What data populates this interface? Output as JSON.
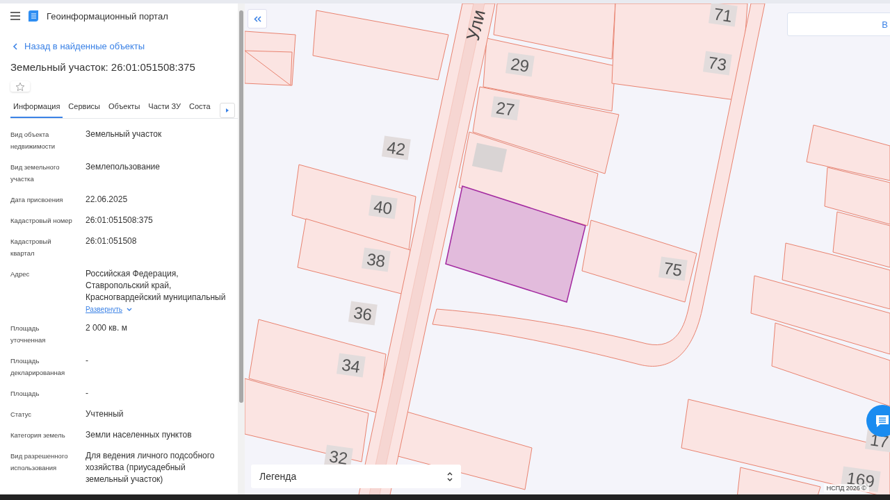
{
  "header": {
    "title": "Геоинформационный портал"
  },
  "back_link": "Назад в найденные объекты",
  "object_title": "Земельный участок: 26:01:051508:375",
  "favorite": {
    "on": false
  },
  "tabs": [
    {
      "label": "Информация",
      "selected": true
    },
    {
      "label": "Сервисы",
      "selected": false
    },
    {
      "label": "Объекты",
      "selected": false
    },
    {
      "label": "Части ЗУ",
      "selected": false
    },
    {
      "label": "Соста",
      "selected": false
    }
  ],
  "fields": [
    {
      "label": "Вид объекта недвижимости",
      "value": "Земельный участок"
    },
    {
      "label": "Вид земельного участка",
      "value": "Землепользование"
    },
    {
      "label": "Дата присвоения",
      "value": "22.06.2025"
    },
    {
      "label": "Кадастровый номер",
      "value": "26:01:051508:375"
    },
    {
      "label": "Кадастровый квартал",
      "value": "26:01:051508"
    },
    {
      "label": "Адрес",
      "value": "Российская Федерация, Ставропольский край, Красногвардейский муниципальный",
      "expand_link": "Развернуть"
    },
    {
      "label": "Площадь уточненная",
      "value": "2 000 кв. м"
    },
    {
      "label": "Площадь декларированная",
      "value": "-"
    },
    {
      "label": "Площадь",
      "value": "-"
    },
    {
      "label": "Статус",
      "value": "Учтенный"
    },
    {
      "label": "Категория земель",
      "value": "Земли населенных пунктов"
    },
    {
      "label": "Вид разрешенного использования",
      "value": "Для ведения личного подсобного хозяйства (приусадебный земельный участок)"
    }
  ],
  "map": {
    "street_label": "Ули",
    "house_numbers": [
      "71",
      "29",
      "73",
      "27",
      "42",
      "40",
      "38",
      "36",
      "75",
      "34",
      "32",
      "169",
      "17"
    ],
    "search_button": "В",
    "legend": "Легенда",
    "attribution": "НСПД 2026 ©"
  }
}
